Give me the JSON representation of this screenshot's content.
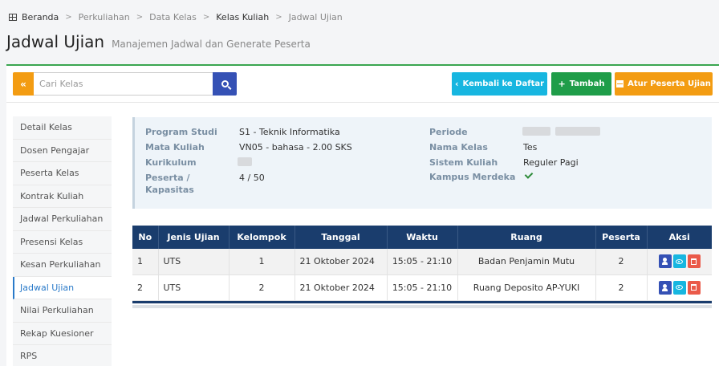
{
  "breadcrumb": {
    "items": [
      "Beranda",
      "Perkuliahan",
      "Data Kelas",
      "Kelas Kuliah",
      "Jadwal Ujian"
    ]
  },
  "header": {
    "title": "Jadwal Ujian",
    "subtitle": "Manajemen Jadwal dan Generate Peserta"
  },
  "toolbar": {
    "search_placeholder": "Cari Kelas",
    "kembali_label": "Kembali ke Daftar",
    "tambah_label": "Tambah",
    "atur_label": "Atur Peserta Ujian"
  },
  "sidebar": {
    "items": [
      {
        "label": "Detail Kelas"
      },
      {
        "label": "Dosen Pengajar"
      },
      {
        "label": "Peserta Kelas"
      },
      {
        "label": "Kontrak Kuliah"
      },
      {
        "label": "Jadwal Perkuliahan"
      },
      {
        "label": "Presensi Kelas"
      },
      {
        "label": "Kesan Perkuliahan"
      },
      {
        "label": "Jadwal Ujian",
        "active": true
      },
      {
        "label": "Nilai Perkuliahan"
      },
      {
        "label": "Rekap Kuesioner"
      },
      {
        "label": "RPS"
      }
    ]
  },
  "info": {
    "program_studi_label": "Program Studi",
    "program_studi_value": "S1 - Teknik Informatika",
    "mata_kuliah_label": "Mata Kuliah",
    "mata_kuliah_value": "VN05 - bahasa - 2.00 SKS",
    "kurikulum_label": "Kurikulum",
    "peserta_label": "Peserta /\nKapasitas",
    "peserta_value": "4 / 50",
    "periode_label": "Periode",
    "nama_kelas_label": "Nama Kelas",
    "nama_kelas_value": "Tes",
    "sistem_kuliah_label": "Sistem Kuliah",
    "sistem_kuliah_value": "Reguler Pagi",
    "kampus_merdeka_label": "Kampus Merdeka"
  },
  "table": {
    "headers": [
      "No",
      "Jenis Ujian",
      "Kelompok",
      "Tanggal",
      "Waktu",
      "Ruang",
      "Peserta",
      "Aksi"
    ],
    "rows": [
      {
        "no": "1",
        "jenis": "UTS",
        "kelompok": "1",
        "tanggal": "21 Oktober 2024",
        "waktu": "15:05 - 21:10",
        "ruang": "Badan Penjamin Mutu",
        "peserta": "2"
      },
      {
        "no": "2",
        "jenis": "UTS",
        "kelompok": "2",
        "tanggal": "21 Oktober 2024",
        "waktu": "15:05 - 21:10",
        "ruang": "Ruang Deposito AP-YUKI",
        "peserta": "2"
      }
    ]
  },
  "colors": {
    "navy": "#1a3d6d",
    "orange": "#f39c12",
    "cyan": "#17b6e0",
    "green": "#1f9d49",
    "blue": "#3551b5",
    "red": "#ea5a4a"
  }
}
